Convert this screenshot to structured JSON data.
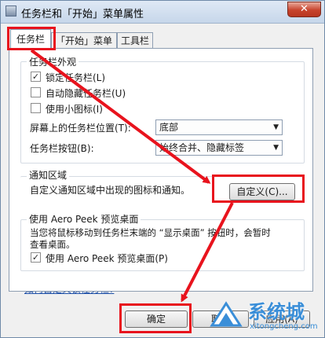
{
  "window": {
    "title": "任务栏和「开始」菜单属性",
    "close_glyph": "✕"
  },
  "tabs": [
    {
      "label": "任务栏"
    },
    {
      "label": "「开始」菜单"
    },
    {
      "label": "工具栏"
    }
  ],
  "appearance": {
    "group_label": "任务栏外观",
    "lock": {
      "label": "锁定任务栏(L)",
      "checked": true
    },
    "autohide": {
      "label": "自动隐藏任务栏(U)",
      "checked": false
    },
    "small_icons": {
      "label": "使用小图标(I)",
      "checked": false
    },
    "location": {
      "label": "屏幕上的任务栏位置(T):",
      "value": "底部"
    },
    "buttons": {
      "label": "任务栏按钮(B):",
      "value": "始终合并、隐藏标签"
    }
  },
  "notification": {
    "group_label": "通知区域",
    "description": "自定义通知区域中出现的图标和通知。",
    "customize_button": "自定义(C)..."
  },
  "aero_peek": {
    "group_label": "使用 Aero Peek 预览桌面",
    "description_line1": "当您将鼠标移动到任务栏末端的 “显示桌面” 按钮时，会暂时",
    "description_line2": "查看桌面。",
    "checkbox": {
      "label": "使用 Aero Peek 预览桌面(P)",
      "checked": true
    }
  },
  "help_link": "如何自定义该任务栏?",
  "footer": {
    "ok": "确定",
    "cancel": "取消",
    "apply": "应用(A)"
  },
  "watermark": {
    "title": "系统城",
    "url": "xitongcheng.com"
  },
  "colors": {
    "highlight": "#e8131d",
    "link": "#1e50a8",
    "watermark": "#3a8ed8"
  }
}
